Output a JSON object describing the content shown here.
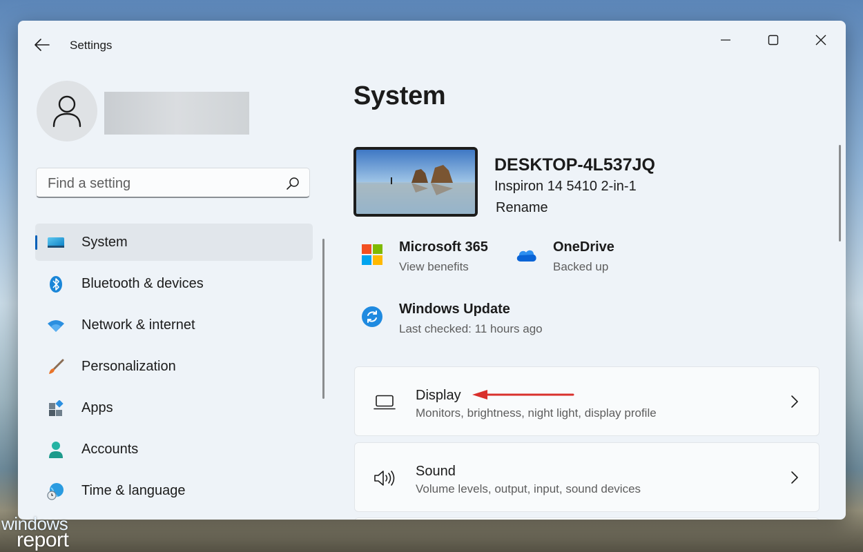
{
  "window": {
    "title": "Settings",
    "user_name": ""
  },
  "search": {
    "placeholder": "Find a setting",
    "value": ""
  },
  "sidebar": {
    "items": [
      {
        "label": "System",
        "icon": "system-monitor-icon",
        "active": true
      },
      {
        "label": "Bluetooth & devices",
        "icon": "bluetooth-icon"
      },
      {
        "label": "Network & internet",
        "icon": "wifi-icon"
      },
      {
        "label": "Personalization",
        "icon": "paintbrush-icon"
      },
      {
        "label": "Apps",
        "icon": "apps-icon"
      },
      {
        "label": "Accounts",
        "icon": "person-icon"
      },
      {
        "label": "Time & language",
        "icon": "globe-clock-icon"
      }
    ]
  },
  "main": {
    "title": "System",
    "device": {
      "name": "DESKTOP-4L537JQ",
      "model": "Inspiron 14 5410 2-in-1",
      "rename": "Rename"
    },
    "tiles": [
      {
        "title": "Microsoft 365",
        "subtitle": "View benefits",
        "icon": "microsoft-logo-icon"
      },
      {
        "title": "OneDrive",
        "subtitle": "Backed up",
        "icon": "onedrive-cloud-icon"
      },
      {
        "title": "Windows Update",
        "subtitle": "Last checked: 11 hours ago",
        "icon": "windows-update-icon"
      }
    ],
    "cards": [
      {
        "title": "Display",
        "subtitle": "Monitors, brightness, night light, display profile",
        "icon": "laptop-display-icon"
      },
      {
        "title": "Sound",
        "subtitle": "Volume levels, output, input, sound devices",
        "icon": "speaker-icon"
      }
    ]
  },
  "watermark": {
    "line1": "windows",
    "line2": "report"
  },
  "colors": {
    "accent": "#005fb8",
    "annotation_arrow": "#d9302c",
    "window_bg": "#eef3f8"
  }
}
